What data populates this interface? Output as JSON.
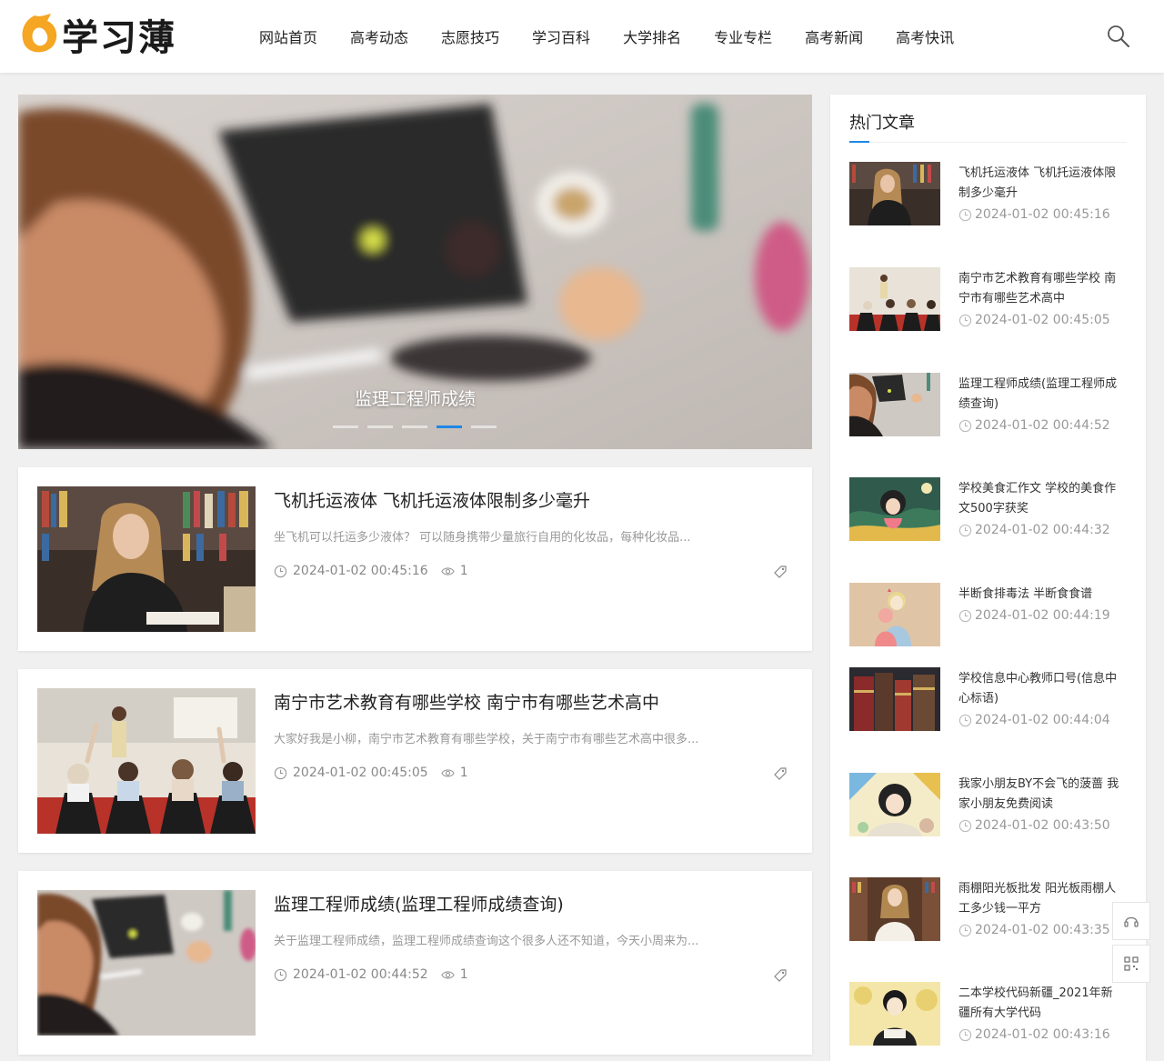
{
  "header": {
    "logo_text": "学习薄",
    "nav": [
      "网站首页",
      "高考动态",
      "志愿技巧",
      "学习百科",
      "大学排名",
      "专业专栏",
      "高考新闻",
      "高考快讯"
    ],
    "accent_color": "#f5a623"
  },
  "banner": {
    "caption": "监理工程师成绩",
    "slide_count": 5,
    "active_index": 3
  },
  "articles": [
    {
      "title": "飞机托运液体 飞机托运液体限制多少毫升",
      "excerpt": "坐飞机可以托运多少液体？ 可以随身携带少量旅行自用的化妆品，每种化妆品...",
      "date": "2024-01-02 00:45:16",
      "views": "1"
    },
    {
      "title": "南宁市艺术教育有哪些学校 南宁市有哪些艺术高中",
      "excerpt": "大家好我是小柳，南宁市艺术教育有哪些学校，关于南宁市有哪些艺术高中很多...",
      "date": "2024-01-02 00:45:05",
      "views": "1"
    },
    {
      "title": "监理工程师成绩(监理工程师成绩查询)",
      "excerpt": "关于监理工程师成绩，监理工程师成绩查询这个很多人还不知道，今天小周来为...",
      "date": "2024-01-02 00:44:52",
      "views": "1"
    }
  ],
  "sidebar": {
    "title": "热门文章",
    "items": [
      {
        "title": "飞机托运液体 飞机托运液体限制多少毫升",
        "date": "2024-01-02 00:45:16"
      },
      {
        "title": "南宁市艺术教育有哪些学校 南宁市有哪些艺术高中",
        "date": "2024-01-02 00:45:05"
      },
      {
        "title": "监理工程师成绩(监理工程师成绩查询)",
        "date": "2024-01-02 00:44:52"
      },
      {
        "title": "学校美食汇作文 学校的美食作文500字获奖",
        "date": "2024-01-02 00:44:32"
      },
      {
        "title": "半断食排毒法 半断食食谱",
        "date": "2024-01-02 00:44:19"
      },
      {
        "title": "学校信息中心教师口号(信息中心标语)",
        "date": "2024-01-02 00:44:04"
      },
      {
        "title": "我家小朋友BY不会飞的菠蔷 我家小朋友免费阅读",
        "date": "2024-01-02 00:43:50"
      },
      {
        "title": "雨棚阳光板批发 阳光板雨棚人工多少钱一平方",
        "date": "2024-01-02 00:43:35"
      },
      {
        "title": "二本学校代码新疆_2021年新疆所有大学代码",
        "date": "2024-01-02 00:43:16"
      }
    ]
  },
  "icons": {
    "search": "search-icon",
    "clock": "clock-icon",
    "eye": "eye-icon",
    "tag": "tag-icon",
    "headset": "headset-icon",
    "qrcode": "qrcode-icon"
  }
}
